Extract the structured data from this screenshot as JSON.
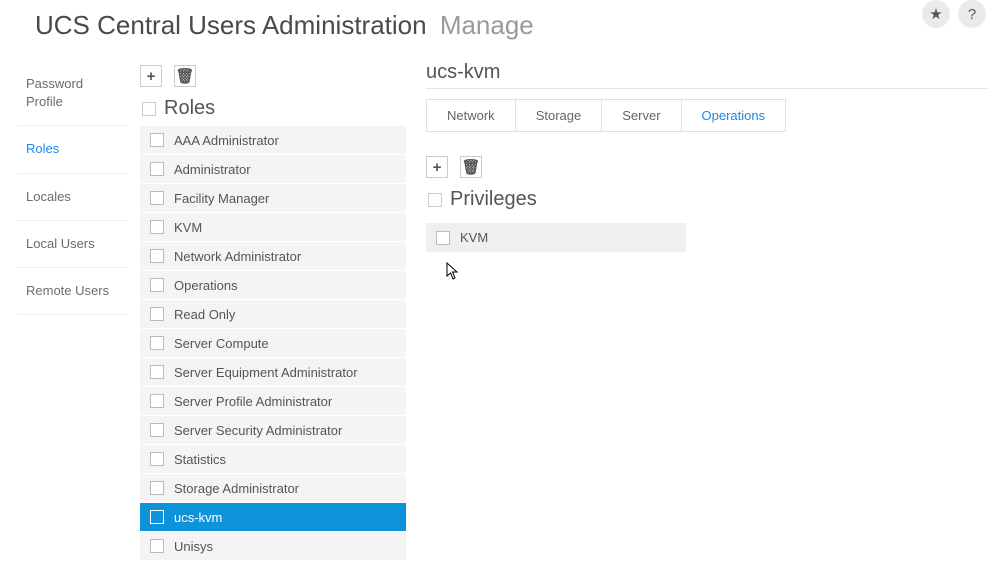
{
  "header": {
    "title": "UCS Central Users Administration",
    "subtitle": "Manage"
  },
  "topIcons": {
    "star": "★",
    "help": "?"
  },
  "sidebar": {
    "items": [
      {
        "label": "Password Profile",
        "active": false
      },
      {
        "label": "Roles",
        "active": true
      },
      {
        "label": "Locales",
        "active": false
      },
      {
        "label": "Local Users",
        "active": false
      },
      {
        "label": "Remote Users",
        "active": false
      }
    ]
  },
  "roles": {
    "sectionTitle": "Roles",
    "addIcon": "+",
    "deleteIcon": "🗑",
    "items": [
      {
        "label": "AAA Administrator",
        "selected": false
      },
      {
        "label": "Administrator",
        "selected": false
      },
      {
        "label": "Facility Manager",
        "selected": false
      },
      {
        "label": "KVM",
        "selected": false
      },
      {
        "label": "Network Administrator",
        "selected": false
      },
      {
        "label": "Operations",
        "selected": false
      },
      {
        "label": "Read Only",
        "selected": false
      },
      {
        "label": "Server Compute",
        "selected": false
      },
      {
        "label": "Server Equipment Administrator",
        "selected": false
      },
      {
        "label": "Server Profile Administrator",
        "selected": false
      },
      {
        "label": "Server Security Administrator",
        "selected": false
      },
      {
        "label": "Statistics",
        "selected": false
      },
      {
        "label": "Storage Administrator",
        "selected": false
      },
      {
        "label": "ucs-kvm",
        "selected": true
      },
      {
        "label": "Unisys",
        "selected": false
      }
    ]
  },
  "detail": {
    "title": "ucs-kvm",
    "tabs": [
      {
        "label": "Network",
        "active": false
      },
      {
        "label": "Storage",
        "active": false
      },
      {
        "label": "Server",
        "active": false
      },
      {
        "label": "Operations",
        "active": true
      }
    ],
    "privileges": {
      "sectionTitle": "Privileges",
      "addIcon": "+",
      "deleteIcon": "🗑",
      "items": [
        {
          "label": "KVM"
        }
      ]
    }
  }
}
